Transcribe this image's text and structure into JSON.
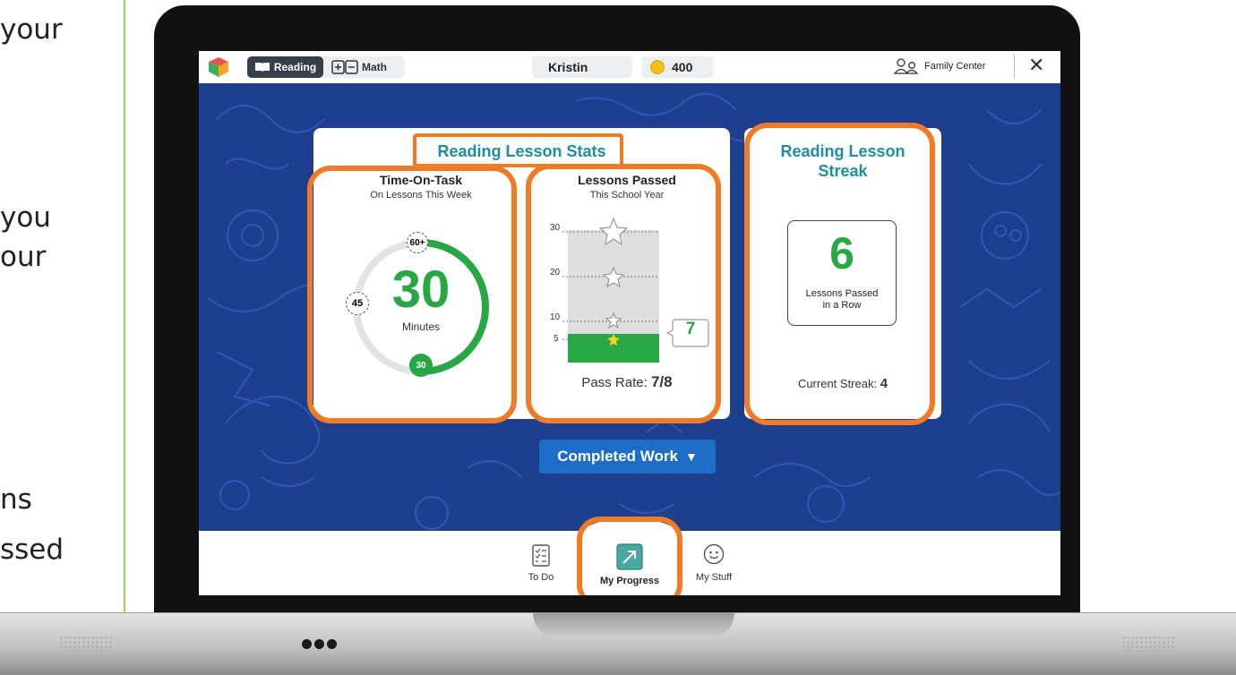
{
  "slide_text": {
    "line1": "your",
    "line2": "you",
    "line3": "our",
    "line4": "ns",
    "line5": "ssed"
  },
  "topbar": {
    "reading_tab": "Reading",
    "math_tab": "Math",
    "user_name": "Kristin",
    "coins": "400",
    "family_center": "Family Center",
    "close": "✕"
  },
  "lesson_stats": {
    "title": "Reading Lesson Stats",
    "time_on_task": {
      "title": "Time-On-Task",
      "subtitle": "On Lessons This Week",
      "value": "30",
      "unit": "Minutes",
      "marker_60": "60+",
      "marker_45": "45",
      "marker_30": "30",
      "progress_fraction": 0.5
    },
    "lessons_passed": {
      "title": "Lessons Passed",
      "subtitle": "This School Year",
      "ticks": [
        "30",
        "20",
        "10",
        "5"
      ],
      "passed_count": "7",
      "pass_rate_label": "Pass Rate:",
      "pass_rate_value": "7/8"
    }
  },
  "streak": {
    "title_line1": "Reading Lesson",
    "title_line2": "Streak",
    "value": "6",
    "label_line1": "Lessons Passed",
    "label_line2": "in a Row",
    "current_label": "Current Streak:",
    "current_value": "4"
  },
  "completed_work_button": "Completed Work",
  "bottom_nav": {
    "todo": "To Do",
    "progress": "My Progress",
    "stuff": "My Stuff"
  },
  "colors": {
    "accent_orange": "#f07a26",
    "teal": "#1c8ea0",
    "green": "#27a844",
    "navy": "#1e3e8e",
    "button_blue": "#1e6ec8"
  }
}
